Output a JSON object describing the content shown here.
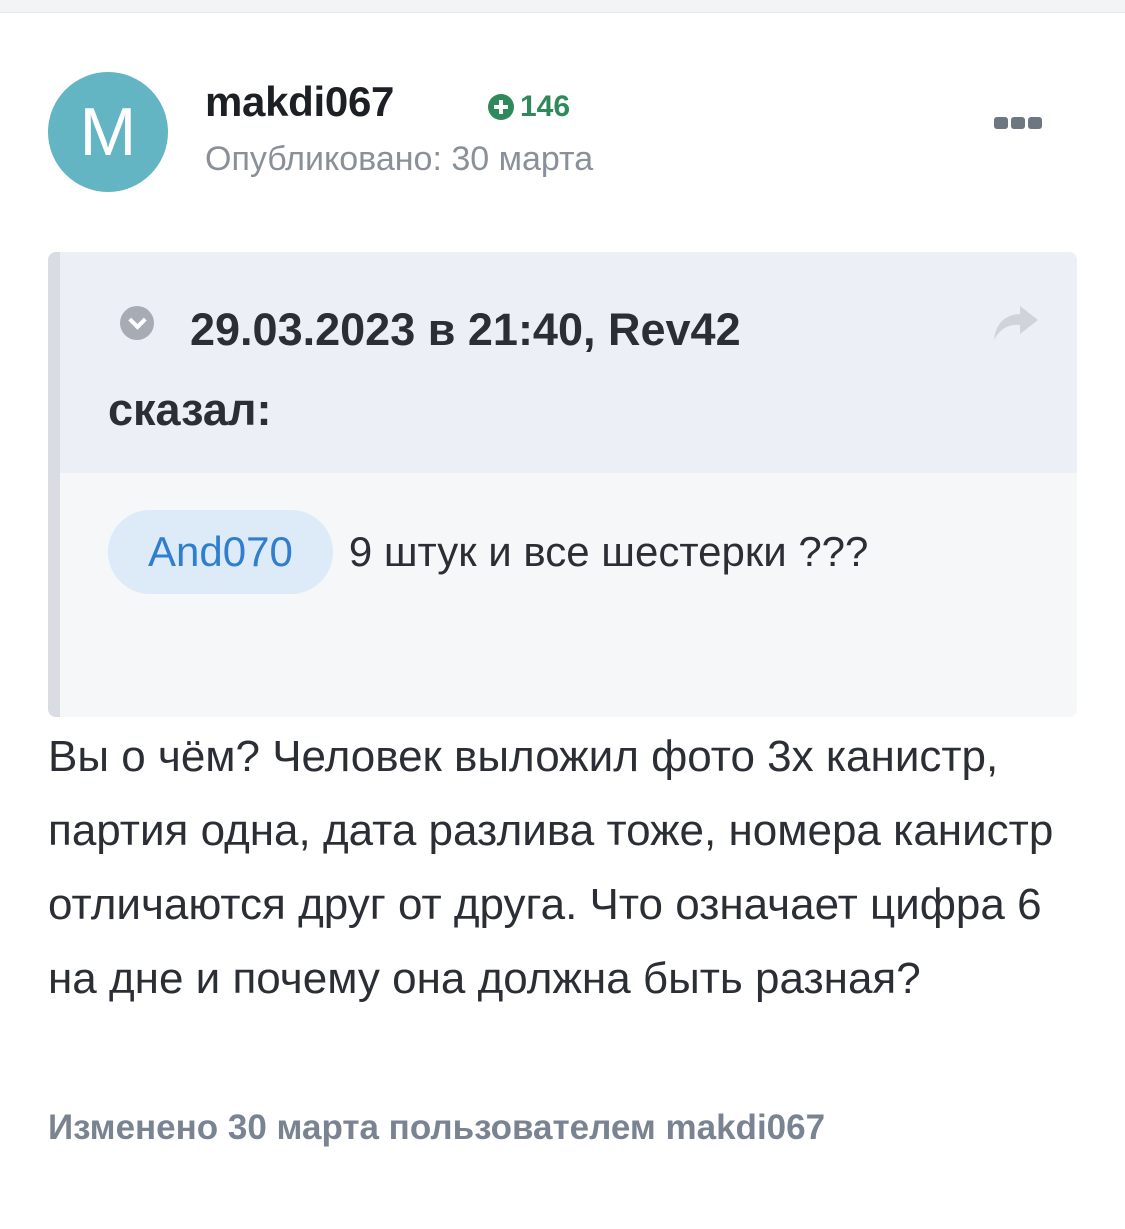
{
  "post": {
    "avatar_letter": "M",
    "avatar_color": "#63b5c3",
    "username": "makdi067",
    "reputation": "146",
    "reputation_color": "#2f8a5b",
    "published": "Опубликовано: 30 марта",
    "more_icon": "more-dots-icon"
  },
  "quote": {
    "citation": "29.03.2023 в 21:40, Rev42 сказал:",
    "toggle_icon": "chevron-down-icon",
    "share_icon": "share-arrow-icon",
    "mention": "And070",
    "text": "9 штук и все шестерки ???"
  },
  "body": {
    "text": "Вы о чём? Человек выложил фото 3х канистр, партия одна, дата разлива тоже, номера канистр отличаются друг от друга. Что означает цифра 6 на дне и почему она должна быть разная?"
  },
  "edited": "Изменено 30 марта пользователем makdi067"
}
